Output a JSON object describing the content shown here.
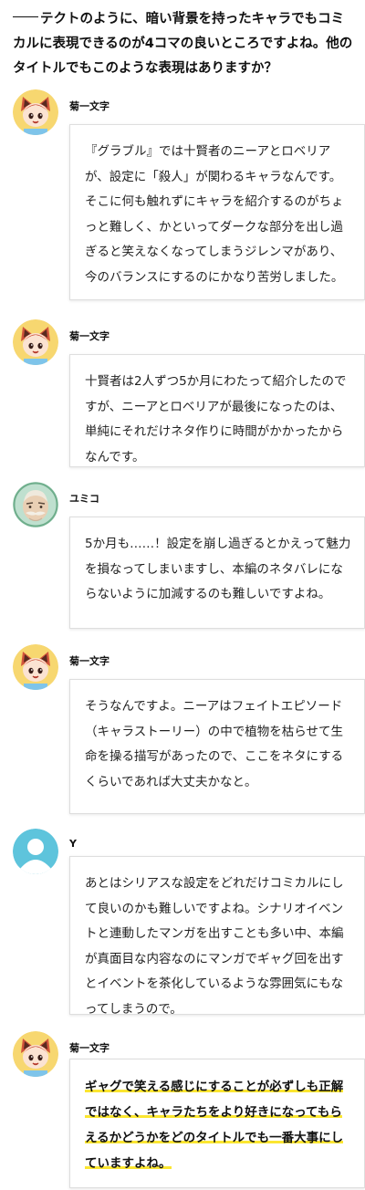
{
  "question": "テクトのように、暗い背景を持ったキャラでもコミカルに表現できるのが4コマの良いところですよね。他のタイトルでもこのような表現はありますか？",
  "entries": [
    {
      "speaker": "菊一文字",
      "avatar": "fox-girl-avatar",
      "text": "『グラブル』では十賢者のニーアとロベリアが、設定に「殺人」が関わるキャラなんです。そこに何も触れずにキャラを紹介するのがちょっと難しく、かといってダークな部分を出し過ぎると笑えなくなってしまうジレンマがあり、今のバランスにするのにかなり苦労しました。"
    },
    {
      "speaker": "菊一文字",
      "avatar": "fox-girl-avatar",
      "text": "十賢者は2人ずつ5か月にわたって紹介したのですが、ニーアとロベリアが最後になったのは、単純にそれだけネタ作りに時間がかかったからなんです。"
    },
    {
      "speaker": "ユミコ",
      "avatar": "old-man-avatar",
      "text": "5か月も……！設定を崩し過ぎるとかえって魅力を損なってしまいますし、本編のネタバレにならないように加減するのも難しいですよね。"
    },
    {
      "speaker": "菊一文字",
      "avatar": "fox-girl-avatar",
      "text": "そうなんですよ。ニーアはフェイトエピソード（キャラストーリー）の中で植物を枯らせて生命を操る描写があったので、ここをネタにするくらいであれば大丈夫かなと。"
    },
    {
      "speaker": "Y",
      "avatar": "default-user-avatar",
      "text": "あとはシリアスな設定をどれだけコミカルにして良いのかも難しいですよね。シナリオイベントと連動したマンガを出すことも多い中、本編が真面目な内容なのにマンガでギャグ回を出すとイベントを茶化しているような雰囲気にもなってしまうので。"
    },
    {
      "speaker": "菊一文字",
      "avatar": "fox-girl-avatar",
      "text": "ギャグで笑える感じにすることが必ずしも正解ではなく、キャラたちをより好きになってもらえるかどうかをどのタイトルでも一番大事にしていますよね。",
      "highlight_color": "#fbe631"
    }
  ]
}
